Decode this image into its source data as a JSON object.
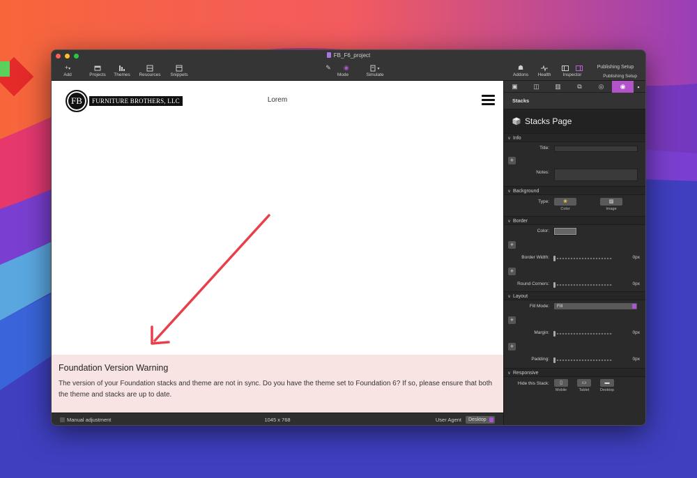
{
  "window": {
    "title": "FB_F6_project"
  },
  "toolbar": {
    "left": [
      {
        "label": "Add",
        "icon": "plus-icon"
      },
      {
        "label": "Projects",
        "icon": "projects-icon"
      },
      {
        "label": "Themes",
        "icon": "themes-icon"
      },
      {
        "label": "Resources",
        "icon": "resources-icon"
      },
      {
        "label": "Snippets",
        "icon": "snippets-icon"
      }
    ],
    "mode_label": "Mode",
    "simulate_label": "Simulate",
    "right": [
      {
        "label": "Addons",
        "icon": "addons-icon"
      },
      {
        "label": "Health",
        "icon": "health-icon"
      },
      {
        "label": "Inspector",
        "icon": "inspector-icon"
      }
    ],
    "publishing_button": "Publishing Setup",
    "publishing_label": "Publishing Setup"
  },
  "page": {
    "logo_initials": "FB",
    "logo_text": "FURNITURE BROTHERS, LLC",
    "nav_text": "Lorem",
    "warning_title": "Foundation Version Warning",
    "warning_body": "The version of your Foundation stacks and theme are not in sync. Do you have the theme set to Foundation 6? If so, please ensure that both the theme and stacks are up to date."
  },
  "statusbar": {
    "manual_adjustment": "Manual adjustment",
    "dimensions": "1045 x 768",
    "user_agent_label": "User Agent",
    "user_agent_value": "Desktop"
  },
  "inspector": {
    "subheader": "Stacks",
    "header": "Stacks Page",
    "info": {
      "section": "Info",
      "title_label": "Title:",
      "notes_label": "Notes:"
    },
    "background": {
      "section": "Background",
      "type_label": "Type:",
      "color_caption": "Color",
      "image_caption": "Image"
    },
    "border": {
      "section": "Border",
      "color_label": "Color:",
      "width_label": "Border Width:",
      "width_value": "0px",
      "corners_label": "Round Corners:",
      "corners_value": "0px"
    },
    "layout": {
      "section": "Layout",
      "fill_label": "Fill Mode:",
      "fill_value": "Fill",
      "margin_label": "Margin:",
      "margin_value": "0px",
      "padding_label": "Padding:",
      "padding_value": "0px"
    },
    "responsive": {
      "section": "Responsive",
      "hide_label": "Hide this Stack:",
      "mobile": "Mobile",
      "tablet": "Tablet",
      "desktop": "Desktop"
    }
  },
  "colors": {
    "accent": "#b253c9",
    "warning_bg": "#f8e4e2",
    "arrow": "#e8404a"
  }
}
